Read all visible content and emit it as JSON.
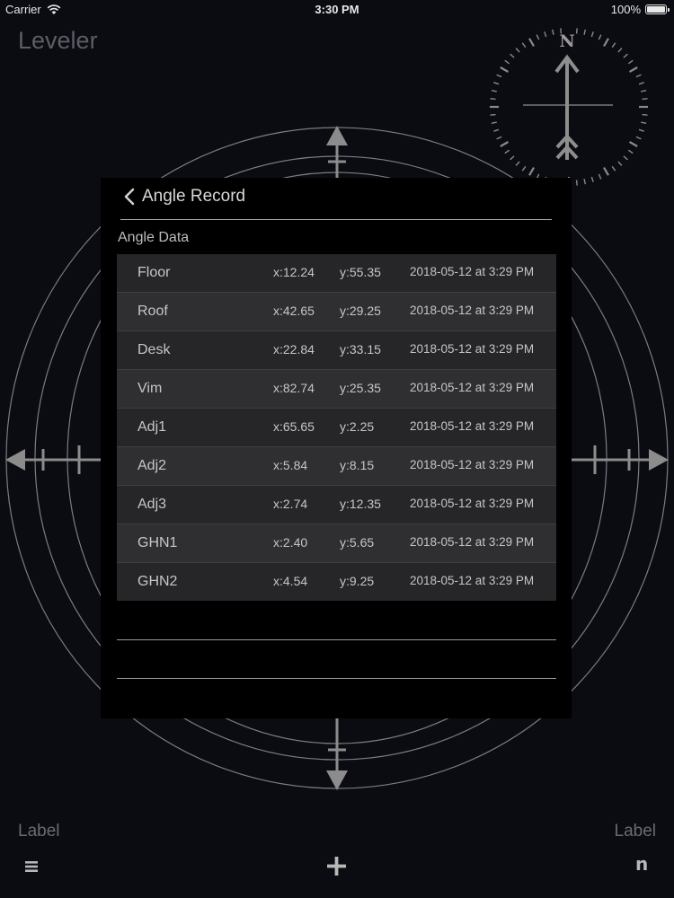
{
  "status_bar": {
    "carrier": "Carrier",
    "time": "3:30 PM",
    "battery": "100%",
    "battery_level": 1.0
  },
  "app": {
    "title": "Leveler"
  },
  "compass": {
    "north_letter": "N"
  },
  "panel": {
    "back_title": "Angle Record",
    "section_title": "Angle Data",
    "rows": [
      {
        "name": "Floor",
        "x": "x:12.24",
        "y": "y:55.35",
        "date": "2018-05-12 at 3:29 PM"
      },
      {
        "name": "Roof",
        "x": "x:42.65",
        "y": "y:29.25",
        "date": "2018-05-12 at 3:29 PM"
      },
      {
        "name": "Desk",
        "x": "x:22.84",
        "y": "y:33.15",
        "date": "2018-05-12 at 3:29 PM"
      },
      {
        "name": "Vim",
        "x": "x:82.74",
        "y": "y:25.35",
        "date": "2018-05-12 at 3:29 PM"
      },
      {
        "name": "Adj1",
        "x": "x:65.65",
        "y": "y:2.25",
        "date": "2018-05-12 at 3:29 PM"
      },
      {
        "name": "Adj2",
        "x": "x:5.84",
        "y": "y:8.15",
        "date": "2018-05-12 at 3:29 PM"
      },
      {
        "name": "Adj3",
        "x": "x:2.74",
        "y": "y:12.35",
        "date": "2018-05-12 at 3:29 PM"
      },
      {
        "name": "GHN1",
        "x": "x:2.40",
        "y": "y:5.65",
        "date": "2018-05-12 at 3:29 PM"
      },
      {
        "name": "GHN2",
        "x": "x:4.54",
        "y": "y:9.25",
        "date": "2018-05-12 at 3:29 PM"
      }
    ]
  },
  "bottom_bar": {
    "left_label": "Label",
    "right_label": "Label",
    "right_icon_text": "n"
  },
  "colors": {
    "background": "#0b0b12",
    "panel": "#000000",
    "row_odd": "#262628",
    "row_even": "#2f2f31",
    "guide_lines": "#8a8a90",
    "arrows": "#8c8c8c"
  }
}
